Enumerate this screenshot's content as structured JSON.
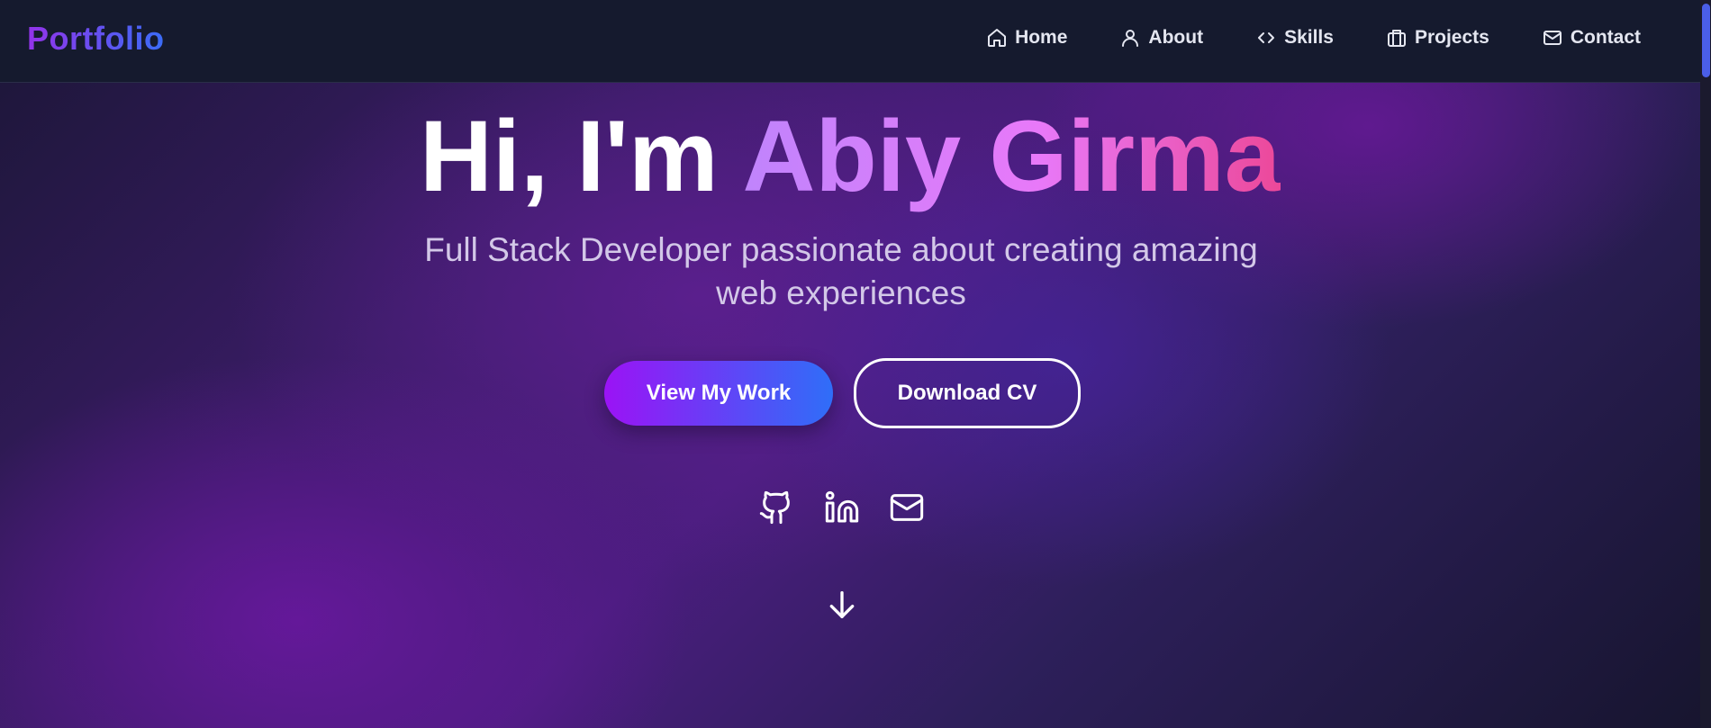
{
  "nav": {
    "logo": "Portfolio",
    "items": [
      {
        "label": "Home",
        "icon": "home-icon"
      },
      {
        "label": "About",
        "icon": "user-icon"
      },
      {
        "label": "Skills",
        "icon": "code-icon"
      },
      {
        "label": "Projects",
        "icon": "briefcase-icon"
      },
      {
        "label": "Contact",
        "icon": "mail-icon"
      }
    ]
  },
  "hero": {
    "greeting": "Hi, I'm ",
    "name": "Abiy Girma",
    "subtitle": "Full Stack Developer passionate about creating amazing web experiences",
    "primary_button": "View My Work",
    "secondary_button": "Download CV"
  },
  "socials": [
    {
      "icon": "github-icon"
    },
    {
      "icon": "linkedin-icon"
    },
    {
      "icon": "mail-icon"
    }
  ],
  "scroll_indicator": {
    "icon": "arrow-down-icon"
  },
  "colors": {
    "nav_bg": "#151a2e",
    "accent_purple": "#9b13f5",
    "accent_blue": "#2f6ef8",
    "name_gradient_start": "#c084fc",
    "name_gradient_end": "#ec4899"
  }
}
